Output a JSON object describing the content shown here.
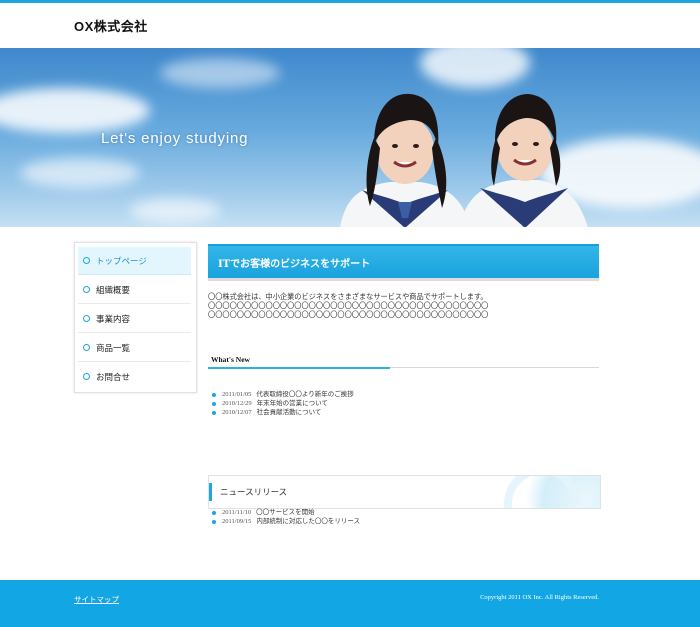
{
  "header": {
    "logo": "OX株式会社"
  },
  "hero": {
    "tagline": "Let's enjoy studying"
  },
  "sidebar": {
    "items": [
      {
        "label": "トップページ"
      },
      {
        "label": "組織概要"
      },
      {
        "label": "事業内容"
      },
      {
        "label": "商品一覧"
      },
      {
        "label": "お問合せ"
      }
    ]
  },
  "main": {
    "title": "ITでお客様のビジネスをサポート",
    "intro": [
      "〇〇株式会社は、中小企業のビジネスをさまざまなサービスや商品でサポートします。",
      "〇〇〇〇〇〇〇〇〇〇〇〇〇〇〇〇〇〇〇〇〇〇〇〇〇〇〇〇〇〇〇〇〇〇〇〇〇〇〇",
      "〇〇〇〇〇〇〇〇〇〇〇〇〇〇〇〇〇〇〇〇〇〇〇〇〇〇〇〇〇〇〇〇〇〇〇〇〇〇〇"
    ]
  },
  "whats_new": {
    "title": "What's New",
    "items": [
      {
        "date": "2011/01/05",
        "text": "代表取締役〇〇より新年のご挨拶"
      },
      {
        "date": "2010/12/29",
        "text": "年末年始の営業について"
      },
      {
        "date": "2010/12/07",
        "text": "社会貢献活動について"
      }
    ]
  },
  "news_release": {
    "title": "ニュースリリース",
    "items": [
      {
        "date": "2011/11/10",
        "text": "〇〇サービスを開始"
      },
      {
        "date": "2011/09/15",
        "text": "内部統制に対応した〇〇をリリース"
      }
    ]
  },
  "footer": {
    "sitemap": "サイトマップ",
    "copyright": "Copyright 2011 OX Inc. All Rights Reserved."
  },
  "colors": {
    "accent": "#1ea6df",
    "footer": "#13a6e5",
    "active_nav_bg": "#e4f6fd"
  }
}
